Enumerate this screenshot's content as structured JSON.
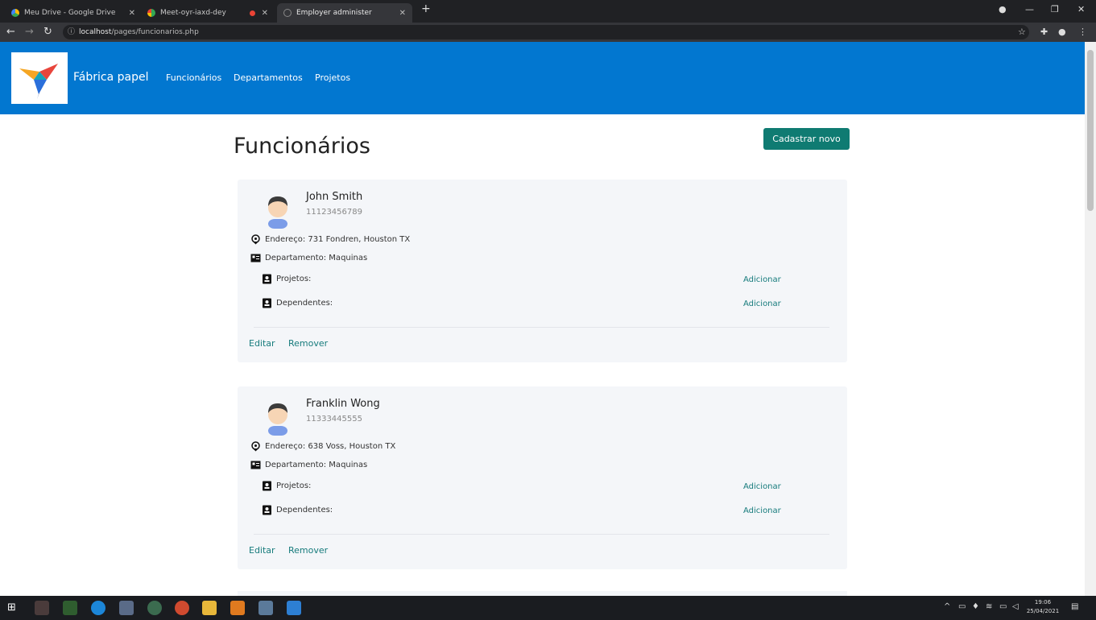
{
  "browser": {
    "tabs": [
      {
        "title": "Meu Drive - Google Drive",
        "active": false
      },
      {
        "title": "Meet-oyr-iaxd-dey",
        "active": false
      },
      {
        "title": "Employer administer",
        "active": true
      }
    ],
    "url_host": "localhost",
    "url_path": "/pages/funcionarios.php"
  },
  "navbar": {
    "brand": "Fábrica papel",
    "links": [
      "Funcionários",
      "Departamentos",
      "Projetos"
    ]
  },
  "page": {
    "title": "Funcionários",
    "new_button": "Cadastrar novo"
  },
  "employees": [
    {
      "name": "John Smith",
      "ssn": "11123456789",
      "address": "Endereço: 731 Fondren, Houston TX",
      "department": "Departamento: Maquinas",
      "projects_label": "Projetos:",
      "dependents_label": "Dependentes:",
      "add_label": "Adicionar",
      "edit_label": "Editar",
      "remove_label": "Remover"
    },
    {
      "name": "Franklin Wong",
      "ssn": "11333445555",
      "address": "Endereço: 638 Voss, Houston TX",
      "department": "Departamento: Maquinas",
      "projects_label": "Projetos:",
      "dependents_label": "Dependentes:",
      "add_label": "Adicionar",
      "edit_label": "Editar",
      "remove_label": "Remover"
    }
  ],
  "taskbar": {
    "time": "19:06",
    "date": "25/04/2021"
  },
  "colors": {
    "navbar": "#0277d0",
    "primary_button": "#0f7b72",
    "link": "#167b7c",
    "card_bg": "#f4f6f9"
  }
}
